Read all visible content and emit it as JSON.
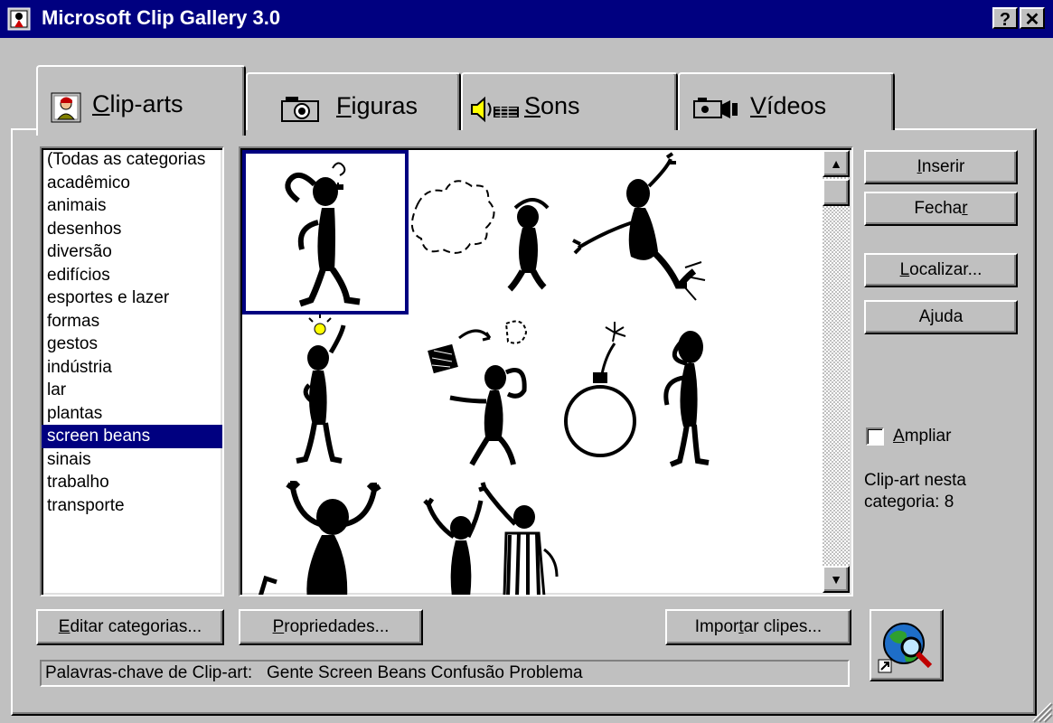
{
  "window": {
    "title": "Microsoft Clip Gallery 3.0",
    "help_label": "?",
    "close_label": "✕"
  },
  "tabs": [
    {
      "prefix": "",
      "accel": "C",
      "rest": "lip-arts",
      "icon": "clip-art-icon"
    },
    {
      "prefix": "",
      "accel": "F",
      "rest": "iguras",
      "icon": "camera-icon"
    },
    {
      "prefix": "",
      "accel": "S",
      "rest": "ons",
      "icon": "speaker-icon"
    },
    {
      "prefix": "",
      "accel": "V",
      "rest": "ídeos",
      "icon": "video-camera-icon"
    }
  ],
  "categories": {
    "items": [
      "(Todas as categorias",
      "acadêmico",
      "animais",
      "desenhos",
      "diversão",
      "edifícios",
      "esportes e lazer",
      "formas",
      "gestos",
      "indústria",
      "lar",
      "plantas",
      "screen beans",
      "sinais",
      "trabalho",
      "transporte"
    ],
    "selected": "screen beans"
  },
  "buttons": {
    "inserir": {
      "accel": "I",
      "rest": "nserir"
    },
    "fechar": {
      "pre": "Fecha",
      "accel": "r",
      "rest": ""
    },
    "localizar": {
      "accel": "L",
      "rest": "ocalizar..."
    },
    "ajuda": {
      "pre": "A",
      "accel": "j",
      "rest": "uda"
    },
    "editar": {
      "accel": "E",
      "rest": "ditar categorias..."
    },
    "propriedades": {
      "accel": "P",
      "rest": "ropriedades..."
    },
    "importar": {
      "pre": "Impor",
      "accel": "t",
      "rest": "ar clipes..."
    }
  },
  "ampliar": {
    "accel": "A",
    "rest": "mpliar",
    "checked": false
  },
  "count": {
    "line1": "Clip-art nesta",
    "line2": "categoria: 8"
  },
  "status": {
    "label": "Palavras-chave de Clip-art:",
    "keywords": "Gente Screen Beans Confusão Problema"
  },
  "icons": {
    "web_button": "globe-search-icon",
    "scroll_up": "arrow-up-icon",
    "scroll_down": "arrow-down-icon"
  },
  "colors": {
    "titlebar": "#000080",
    "face": "#c0c0c0",
    "selection": "#000080"
  }
}
